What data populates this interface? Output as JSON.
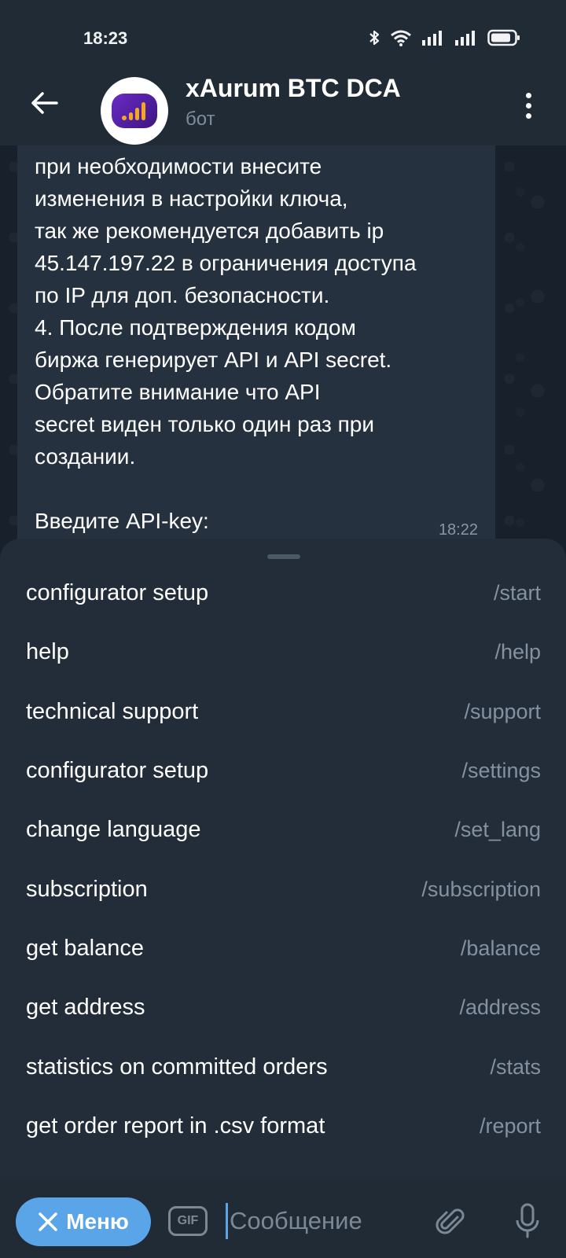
{
  "status_bar": {
    "time": "18:23",
    "icons": [
      "bluetooth-icon",
      "wifi-icon",
      "signal-icon",
      "signal-icon",
      "battery-icon"
    ]
  },
  "header": {
    "title": "xAurum BTC DCA",
    "subtitle": "бот",
    "back_icon": "arrow-left-icon",
    "more_icon": "more-vertical-icon"
  },
  "message": {
    "text": "при необходимости внесите\nизменения в настройки ключа,\nтак же рекомендуется добавить ip\n45.147.197.22 в ограничения доступа\nпо IP для доп. безопасности.\n4. После подтверждения кодом\nбиржа генерирует API и API secret.\nОбратите внимание что API\nsecret виден только один раз при\nсоздании.\n\nВведите API-key:",
    "time": "18:22"
  },
  "commands": [
    {
      "name": "configurator setup",
      "command": "/start"
    },
    {
      "name": "help",
      "command": "/help"
    },
    {
      "name": "technical support",
      "command": "/support"
    },
    {
      "name": "configurator setup",
      "command": "/settings"
    },
    {
      "name": "change language",
      "command": "/set_lang"
    },
    {
      "name": "subscription",
      "command": "/subscription"
    },
    {
      "name": "get balance",
      "command": "/balance"
    },
    {
      "name": "get address",
      "command": "/address"
    },
    {
      "name": "statistics on committed orders",
      "command": "/stats"
    },
    {
      "name": "get order report in .csv format",
      "command": "/report"
    }
  ],
  "input_bar": {
    "menu_label": "Меню",
    "gif_label": "GIF",
    "placeholder": "Сообщение"
  },
  "colors": {
    "accent": "#5aa4e8",
    "background": "#1b2430",
    "sheet": "#232d39"
  }
}
